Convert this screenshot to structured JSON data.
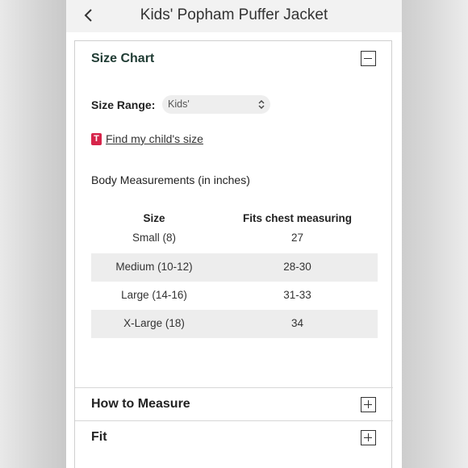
{
  "header": {
    "back_icon": "chevron-left-icon",
    "title": "Kids' Popham Puffer Jacket"
  },
  "size_chart": {
    "heading": "Size Chart",
    "toggle_icon": "minus-icon",
    "range_label": "Size Range:",
    "range_value": "Kids'",
    "select_icon": "chevron-up-down-icon",
    "finder_badge": "T",
    "finder_link": "Find my child's size",
    "measurements_title": "Body Measurements (in inches)",
    "table": {
      "headers": [
        "Size",
        "Fits chest measuring"
      ],
      "rows": [
        [
          "Small (8)",
          "27"
        ],
        [
          "Medium (10-12)",
          "28-30"
        ],
        [
          "Large (14-16)",
          "31-33"
        ],
        [
          "X-Large (18)",
          "34"
        ]
      ]
    }
  },
  "sections": [
    {
      "label": "How to Measure",
      "toggle_icon": "plus-icon"
    },
    {
      "label": "Fit",
      "toggle_icon": "plus-icon"
    }
  ],
  "colors": {
    "heading_green": "#1f3b33",
    "badge_red": "#d6244a",
    "row_shade": "#ededed"
  }
}
